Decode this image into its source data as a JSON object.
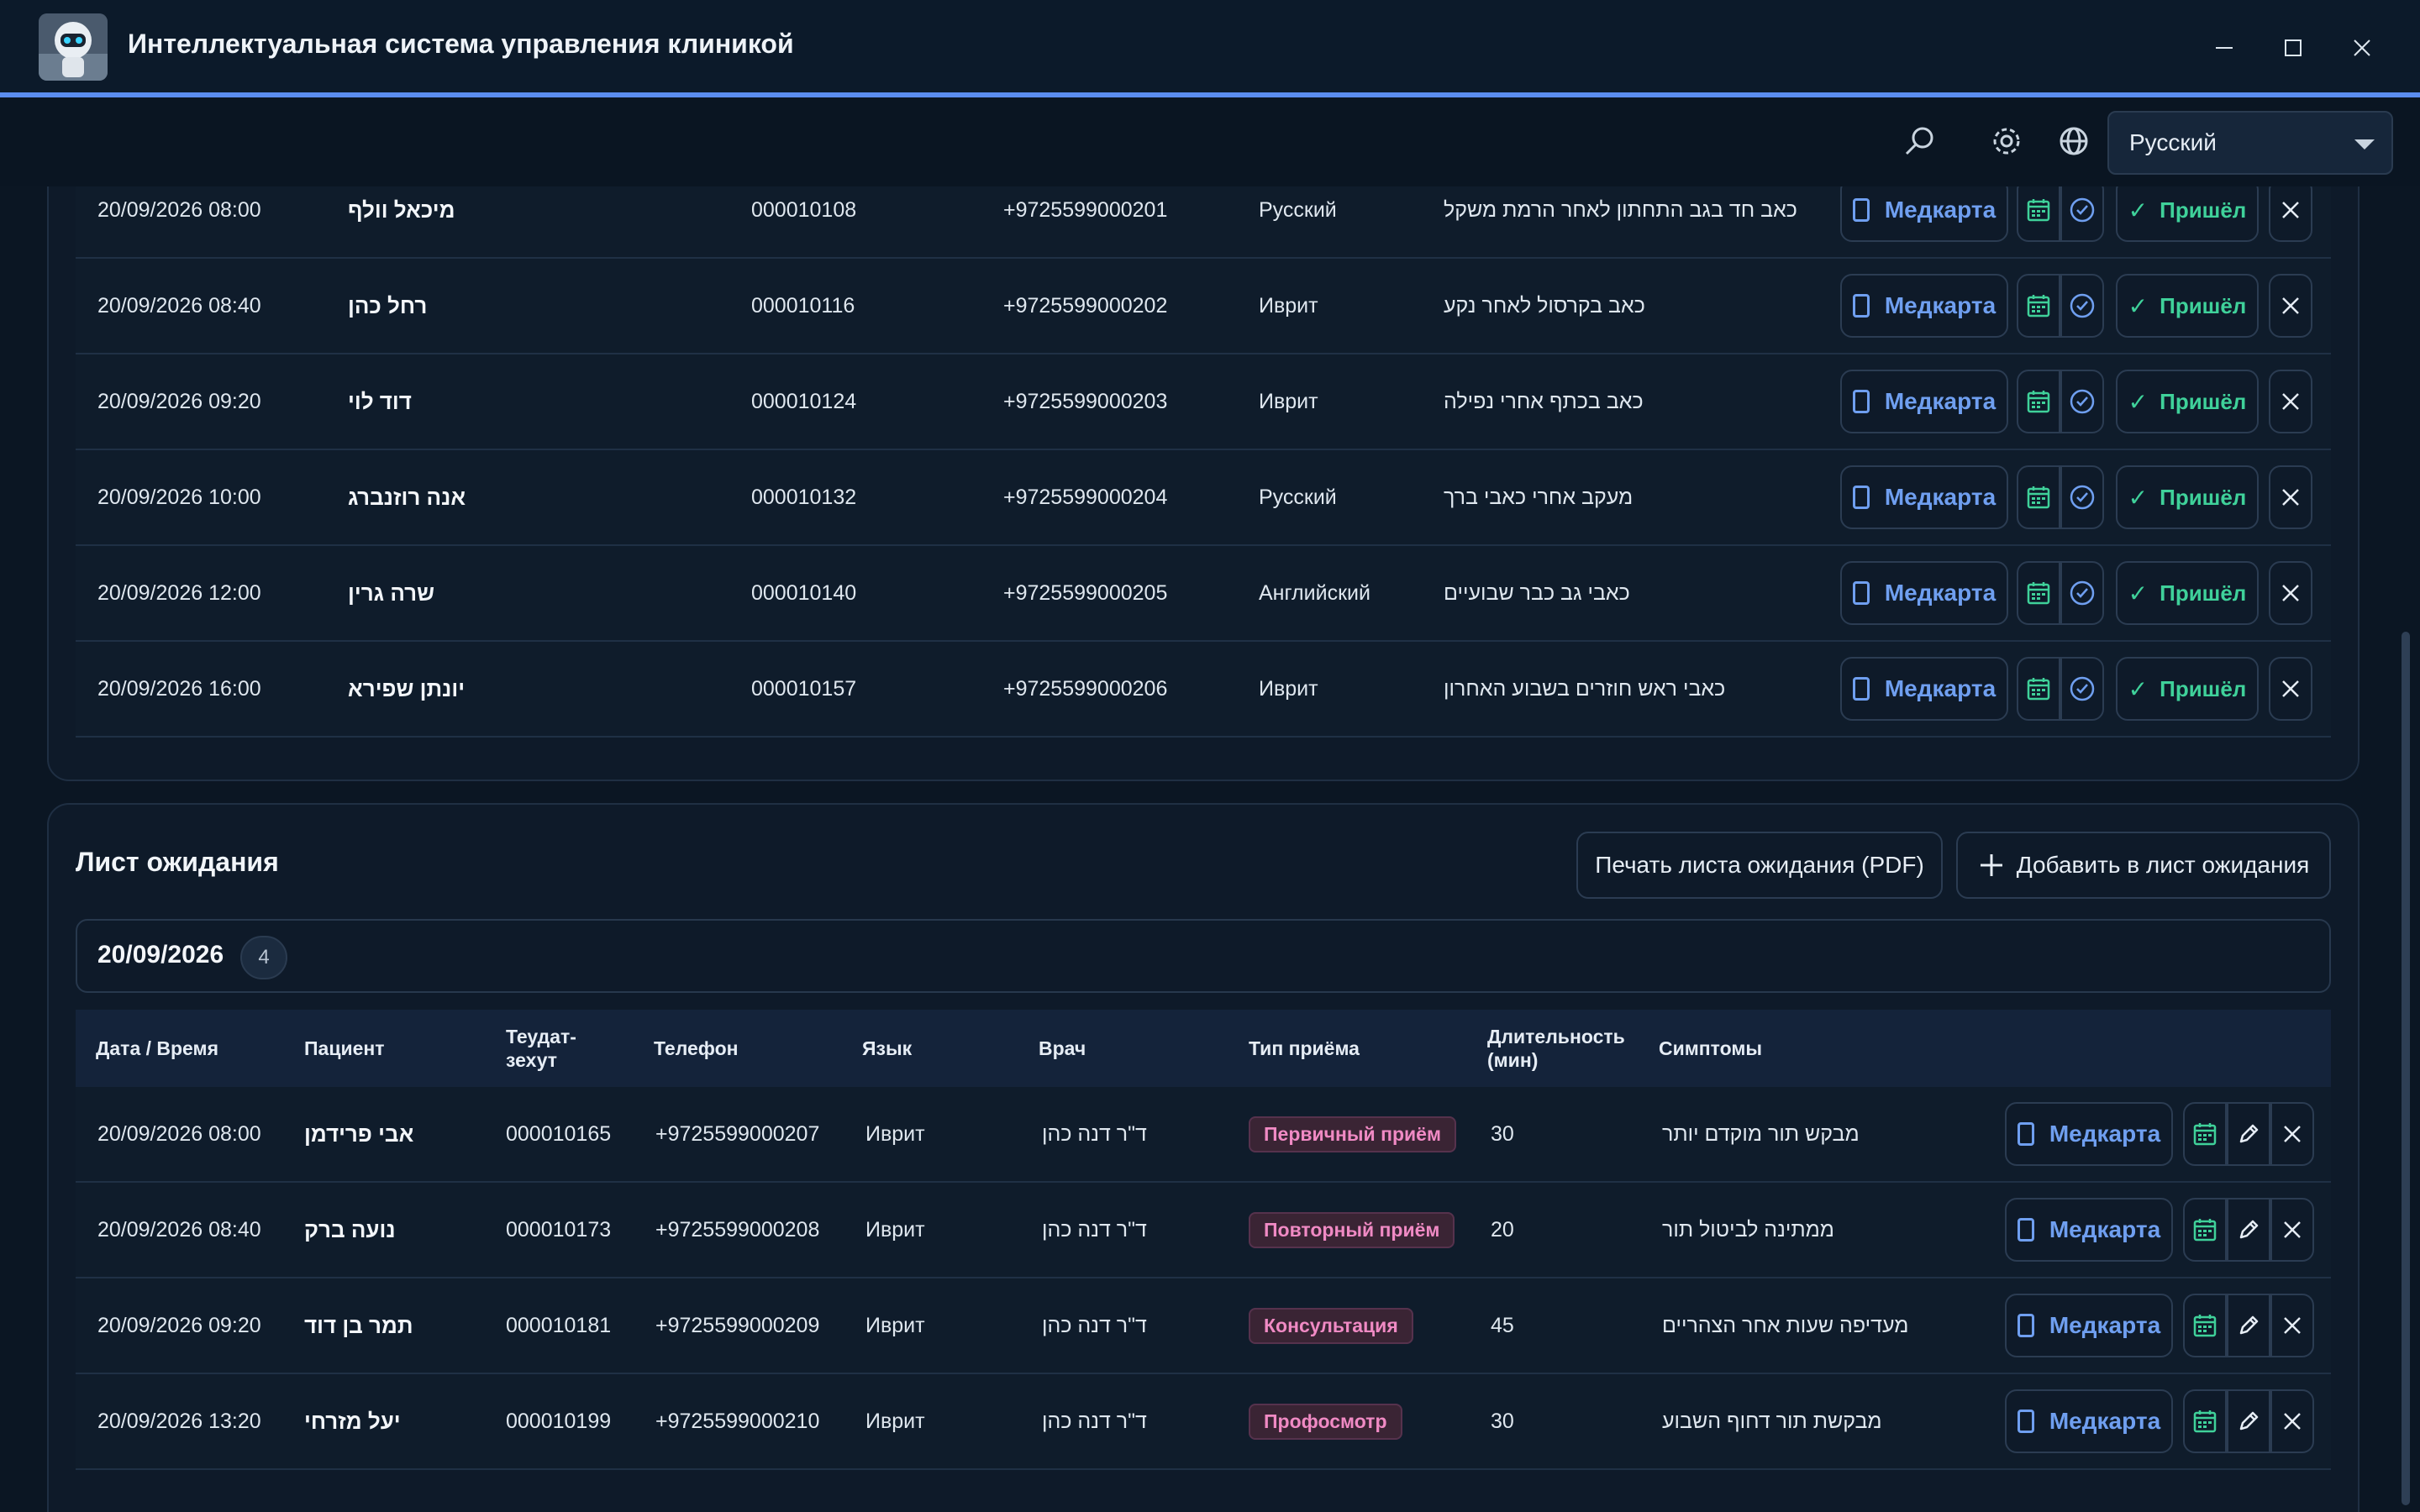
{
  "window": {
    "title": "Интеллектуальная система управления клиникой"
  },
  "header": {
    "language_selected": "Русский"
  },
  "appointments": {
    "rows": [
      {
        "datetime": "20/09/2026 08:00",
        "patient": "מיכאל וולף",
        "id": "000010108",
        "phone": "+9725599000201",
        "language": "Русский",
        "symptoms": "כאב חד בגב התחתון לאחר הרמת משקל"
      },
      {
        "datetime": "20/09/2026 08:40",
        "patient": "רחל כהן",
        "id": "000010116",
        "phone": "+9725599000202",
        "language": "Иврит",
        "symptoms": "כאב בקרסול לאחר נקע"
      },
      {
        "datetime": "20/09/2026 09:20",
        "patient": "דוד לוי",
        "id": "000010124",
        "phone": "+9725599000203",
        "language": "Иврит",
        "symptoms": "כאב בכתף אחרי נפילה"
      },
      {
        "datetime": "20/09/2026 10:00",
        "patient": "אנה רוזנברג",
        "id": "000010132",
        "phone": "+9725599000204",
        "language": "Русский",
        "symptoms": "מעקב אחרי כאבי ברך"
      },
      {
        "datetime": "20/09/2026 12:00",
        "patient": "שרה גרין",
        "id": "000010140",
        "phone": "+9725599000205",
        "language": "Английский",
        "symptoms": "כאבי גב כבר שבועיים"
      },
      {
        "datetime": "20/09/2026 16:00",
        "patient": "יונתן שפירא",
        "id": "000010157",
        "phone": "+9725599000206",
        "language": "Иврит",
        "symptoms": "כאבי ראש חוזרים בשבוע האחרון"
      }
    ],
    "medcard_label": "Медкарта",
    "arrived_label": "Пришёл"
  },
  "waitlist": {
    "title": "Лист ожидания",
    "print_button": "Печать листа ожидания (PDF)",
    "add_button": "Добавить в лист ожидания",
    "date": "20/09/2026",
    "count": "4",
    "columns": {
      "datetime": "Дата / Время",
      "patient": "Пациент",
      "id_line1": "Теудат-",
      "id_line2": "зехут",
      "phone": "Телефон",
      "language": "Язык",
      "doctor": "Врач",
      "visit_type": "Тип приёма",
      "duration_line1": "Длительность",
      "duration_line2": "(мин)",
      "symptoms": "Симптомы"
    },
    "rows": [
      {
        "datetime": "20/09/2026 08:00",
        "patient": "אבי פרידמן",
        "id": "000010165",
        "phone": "+9725599000207",
        "language": "Иврит",
        "doctor": "ד\"ר דנה כהן",
        "visit_type": "Первичный приём",
        "duration": "30",
        "symptoms": "מבקש תור מוקדם יותר"
      },
      {
        "datetime": "20/09/2026 08:40",
        "patient": "נועה ברק",
        "id": "000010173",
        "phone": "+9725599000208",
        "language": "Иврит",
        "doctor": "ד\"ר דנה כהן",
        "visit_type": "Повторный приём",
        "duration": "20",
        "symptoms": "ממתינה לביטול תור"
      },
      {
        "datetime": "20/09/2026 09:20",
        "patient": "תמר בן דוד",
        "id": "000010181",
        "phone": "+9725599000209",
        "language": "Иврит",
        "doctor": "ד\"ר דנה כהן",
        "visit_type": "Консультация",
        "duration": "45",
        "symptoms": "מעדיפה שעות אחר הצהריים"
      },
      {
        "datetime": "20/09/2026 13:20",
        "patient": "יעל מזרחי",
        "id": "000010199",
        "phone": "+9725599000210",
        "language": "Иврит",
        "doctor": "ד\"ר דנה כהן",
        "visit_type": "Профосмотр",
        "duration": "30",
        "symptoms": "מבקשת תור דחוף השבוע"
      }
    ],
    "medcard_label": "Медкарта"
  },
  "colors": {
    "accent": "#5b8def",
    "success": "#3fd19a",
    "tag": "#f08ac4"
  }
}
